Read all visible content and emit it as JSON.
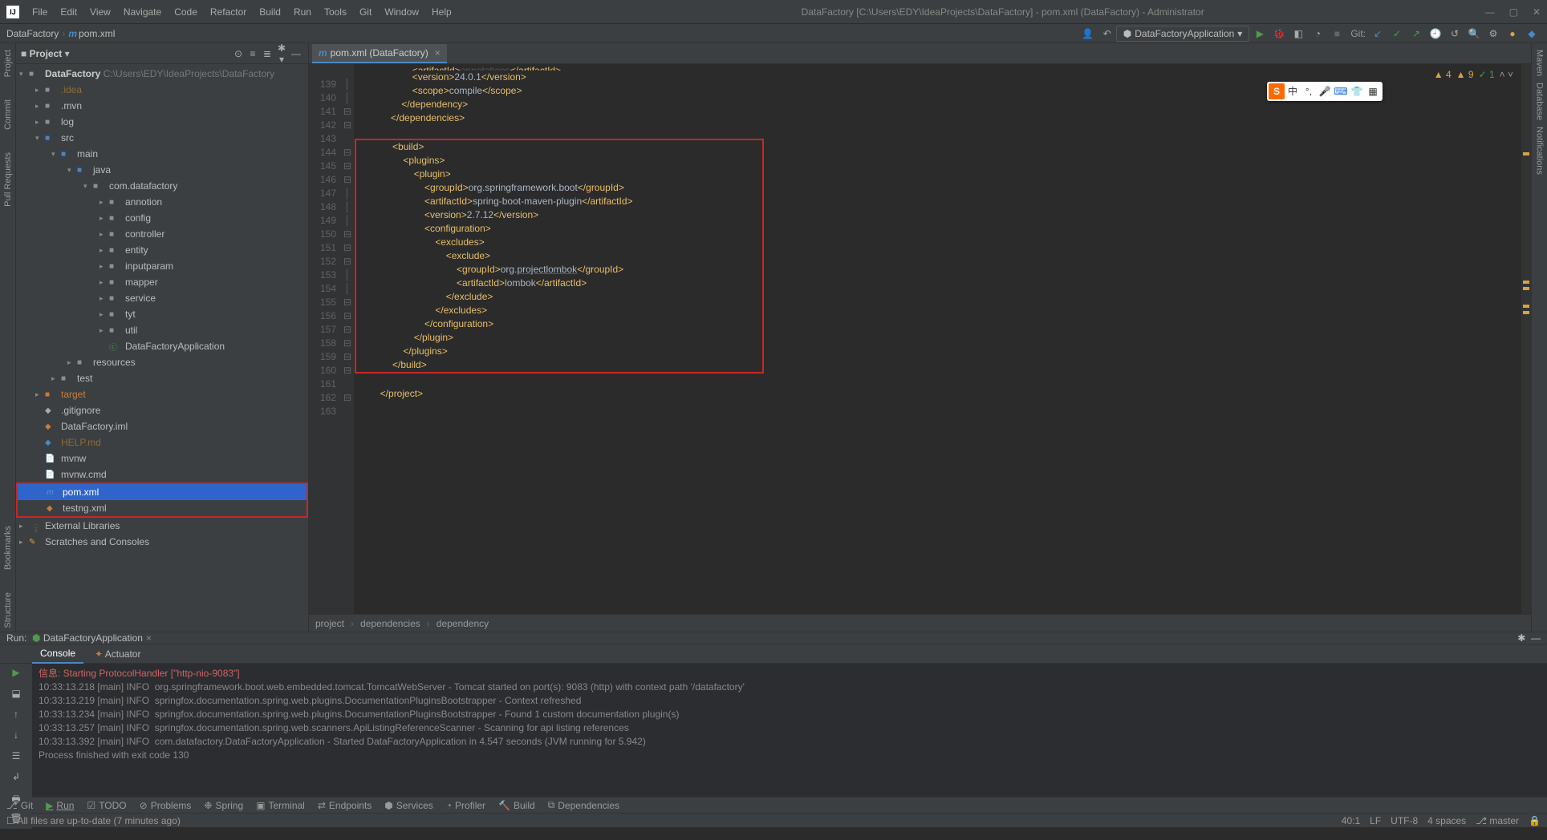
{
  "title": "DataFactory [C:\\Users\\EDY\\IdeaProjects\\DataFactory] - pom.xml (DataFactory) - Administrator",
  "menus": [
    "File",
    "Edit",
    "View",
    "Navigate",
    "Code",
    "Refactor",
    "Build",
    "Run",
    "Tools",
    "Git",
    "Window",
    "Help"
  ],
  "breadcrumb": {
    "root": "DataFactory",
    "file": "pom.xml"
  },
  "run_config": "DataFactoryApplication",
  "git_label": "Git:",
  "project_panel": {
    "title": "Project",
    "root": {
      "name": "DataFactory",
      "path": "C:\\Users\\EDY\\IdeaProjects\\DataFactory"
    },
    "idea": ".idea",
    "mvn": ".mvn",
    "log": "log",
    "src": "src",
    "main": "main",
    "java": "java",
    "pkg": "com.datafactory",
    "pkgs": [
      "annotion",
      "config",
      "controller",
      "entity",
      "inputparam",
      "mapper",
      "service",
      "tyt",
      "util"
    ],
    "app": "DataFactoryApplication",
    "resources": "resources",
    "test": "test",
    "target": "target",
    "gitignore": ".gitignore",
    "iml": "DataFactory.iml",
    "help": "HELP.md",
    "mvnw": "mvnw",
    "mvnwcmd": "mvnw.cmd",
    "pom": "pom.xml",
    "testng": "testng.xml",
    "ext": "External Libraries",
    "scratch": "Scratches and Consoles"
  },
  "editor_tab": "pom.xml (DataFactory)",
  "gutter_warnings": {
    "w1": "4",
    "w2": "9",
    "ok": "1"
  },
  "line_numbers": [
    "",
    "139",
    "140",
    "141",
    "142",
    "143",
    "144",
    "145",
    "146",
    "147",
    "148",
    "149",
    "150",
    "151",
    "152",
    "153",
    "154",
    "155",
    "156",
    "157",
    "158",
    "159",
    "160",
    "161",
    "162",
    "163"
  ],
  "code": [
    "                    <artifactId>annotations</artifactId>",
    "                    <version>24.0.1</version>",
    "                    <scope>compile</scope>",
    "                </dependency>",
    "            </dependencies>",
    "",
    "            <build>",
    "                <plugins>",
    "                    <plugin>",
    "                        <groupId>org.springframework.boot</groupId>",
    "                        <artifactId>spring-boot-maven-plugin</artifactId>",
    "                        <version>2.7.12</version>",
    "                        <configuration>",
    "                            <excludes>",
    "                                <exclude>",
    "                                    <groupId>org.projectlombok</groupId>",
    "                                    <artifactId>lombok</artifactId>",
    "                                </exclude>",
    "                            </excludes>",
    "                        </configuration>",
    "                    </plugin>",
    "                </plugins>",
    "            </build>",
    "",
    "        </project>",
    ""
  ],
  "editor_breadcrumb": [
    "project",
    "dependencies",
    "dependency"
  ],
  "run_panel": {
    "title": "Run:",
    "config": "DataFactoryApplication",
    "tabs": [
      "Console",
      "Actuator"
    ],
    "lines": [
      "信息: Starting ProtocolHandler [\"http-nio-9083\"]",
      "10:33:13.218 [main] INFO  org.springframework.boot.web.embedded.tomcat.TomcatWebServer - Tomcat started on port(s): 9083 (http) with context path '/datafactory'",
      "10:33:13.219 [main] INFO  springfox.documentation.spring.web.plugins.DocumentationPluginsBootstrapper - Context refreshed",
      "10:33:13.234 [main] INFO  springfox.documentation.spring.web.plugins.DocumentationPluginsBootstrapper - Found 1 custom documentation plugin(s)",
      "10:33:13.257 [main] INFO  springfox.documentation.spring.web.scanners.ApiListingReferenceScanner - Scanning for api listing references",
      "10:33:13.392 [main] INFO  com.datafactory.DataFactoryApplication - Started DataFactoryApplication in 4.547 seconds (JVM running for 5.942)",
      "",
      "Process finished with exit code 130"
    ]
  },
  "bottom_tabs": [
    "Git",
    "Run",
    "TODO",
    "Problems",
    "Spring",
    "Terminal",
    "Endpoints",
    "Services",
    "Profiler",
    "Build",
    "Dependencies"
  ],
  "status": {
    "msg": "All files are up-to-date (7 minutes ago)",
    "pos": "40:1",
    "le": "LF",
    "enc": "UTF-8",
    "indent": "4 spaces",
    "branch": "master"
  },
  "left_strips": [
    "Project",
    "Commit",
    "Pull Requests",
    "Structure",
    "Bookmarks"
  ],
  "right_strips": [
    "Maven",
    "Database",
    "Notifications"
  ]
}
